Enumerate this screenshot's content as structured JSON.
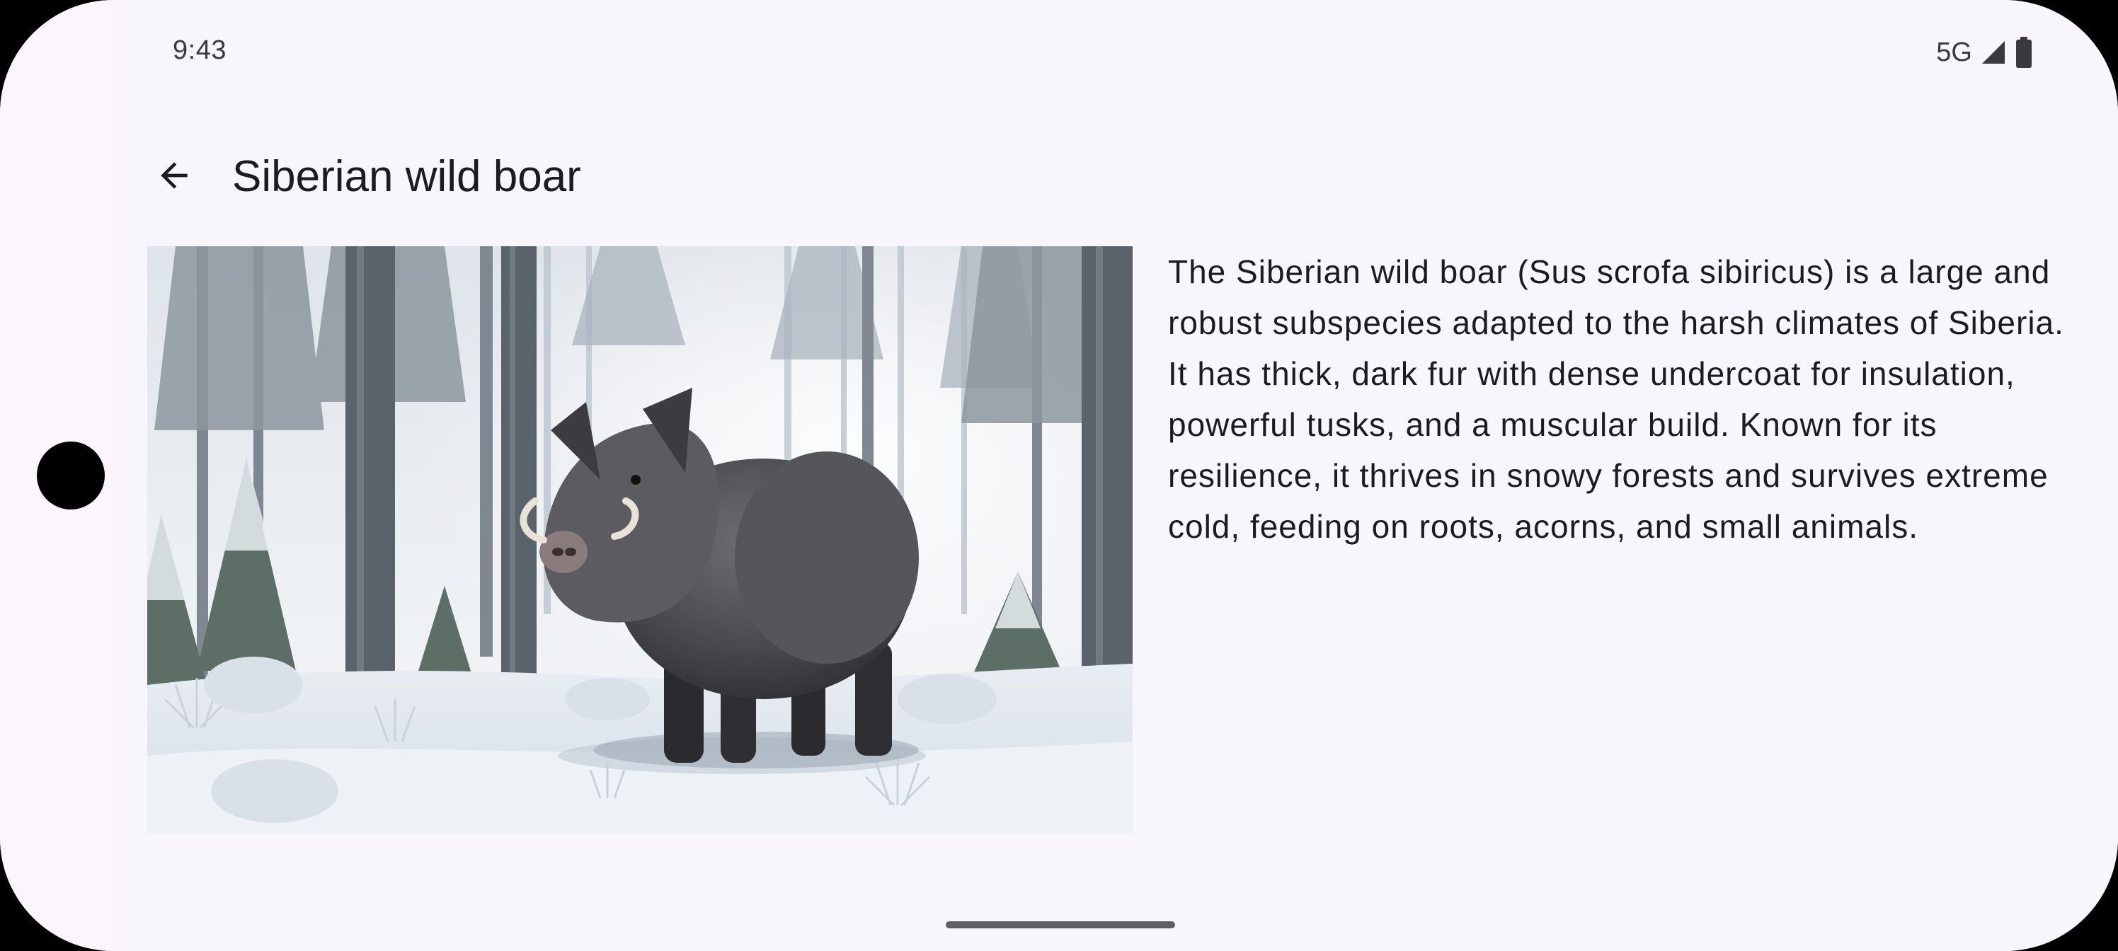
{
  "status_bar": {
    "time": "9:43",
    "network": "5G",
    "signal_icon": "cellular-signal-icon",
    "battery_icon": "battery-full-icon"
  },
  "app_bar": {
    "back_icon": "arrow-back-icon",
    "title": "Siberian wild boar"
  },
  "content": {
    "image_subject": "wild boar in a snowy forest",
    "description": "The Siberian wild boar (Sus scrofa sibiricus) is a large and robust subspecies adapted to the harsh climates of Siberia. It has thick, dark fur with dense undercoat for insulation, powerful tusks, and a muscular build. Known for its resilience, it thrives in snowy forests and survives extreme cold, feeding on roots, acorns, and small animals."
  },
  "colors": {
    "background": "#f8f6fc",
    "text": "#1c1b1f"
  }
}
